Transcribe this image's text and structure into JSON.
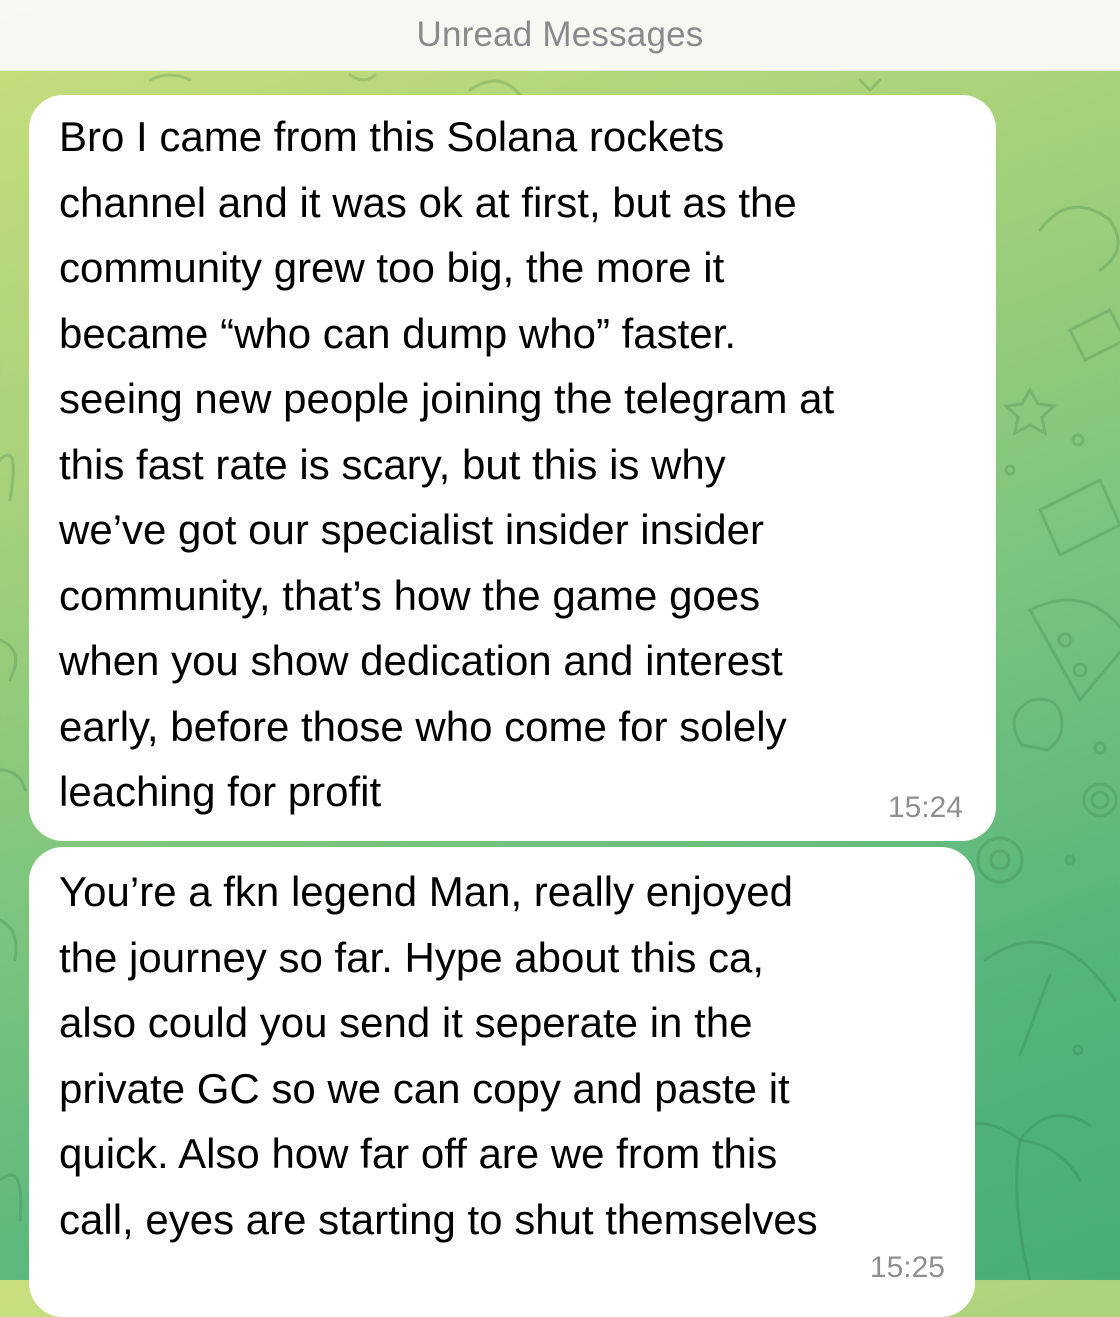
{
  "header": {
    "unread_label": "Unread Messages"
  },
  "messages": [
    {
      "text": "Bro I came from this Solana rockets\nchannel and it was ok at first, but as the\ncommunity grew too big, the more it\nbecame “who can dump who” faster.\nseeing new people joining the telegram at\nthis fast rate is scary, but this is why\nwe’ve got our specialist insider insider\ncommunity, that’s how the game goes\nwhen you show dedication and interest\nearly, before those who come for solely\nleaching for profit",
      "time": "15:24"
    },
    {
      "text": "You’re a fkn legend Man, really enjoyed\nthe journey so far. Hype about this ca,\nalso could you send it seperate in the\nprivate GC so we can copy and paste it\nquick. Also how far off are we from this\ncall, eyes are starting to shut themselves",
      "time": "15:25"
    }
  ],
  "colors": {
    "bubble": "#ffffff",
    "wallpaper_top": "#c9df7e",
    "wallpaper_bottom": "#48ad78",
    "time_text": "#8e8e93"
  }
}
